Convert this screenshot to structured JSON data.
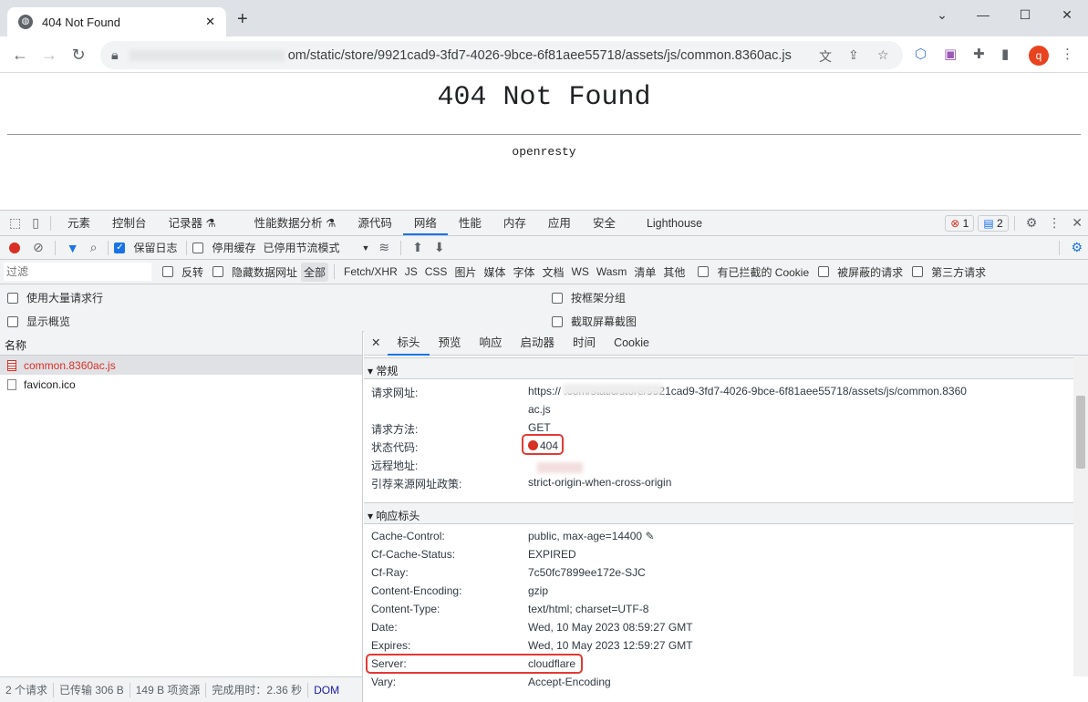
{
  "browser": {
    "tab_title": "404 Not Found",
    "new_tab": "+",
    "url": "om/static/store/9921cad9-3fd7-4026-9bce-6f81aee55718/assets/js/common.8360ac.js",
    "avatar": "q"
  },
  "page": {
    "heading": "404 Not Found",
    "server": "openresty"
  },
  "devtools": {
    "tabs": [
      "元素",
      "控制台",
      "记录器 ⚗",
      "性能数据分析 ⚗",
      "源代码",
      "网络",
      "性能",
      "内存",
      "应用",
      "安全",
      "Lighthouse"
    ],
    "error_count": "1",
    "message_count": "2",
    "toolbar": {
      "preserve_log": "保留日志",
      "disable_cache": "停用缓存",
      "throttling": "已停用节流模式"
    },
    "filter": {
      "placeholder": "过滤",
      "invert": "反转",
      "hide_data_urls": "隐藏数据网址",
      "types": [
        "全部",
        "Fetch/XHR",
        "JS",
        "CSS",
        "图片",
        "媒体",
        "字体",
        "文档",
        "WS",
        "Wasm",
        "清单",
        "其他"
      ],
      "blocked_cookies": "有已拦截的 Cookie",
      "blocked_requests": "被屏蔽的请求",
      "third_party": "第三方请求"
    },
    "options": {
      "large_rows": "使用大量请求行",
      "group_by_frame": "按框架分组",
      "overview": "显示概览",
      "screenshots": "截取屏幕截图"
    },
    "list": {
      "header": "名称",
      "items": [
        "common.8360ac.js",
        "favicon.ico"
      ]
    },
    "detail_tabs": [
      "标头",
      "预览",
      "响应",
      "启动器",
      "时间",
      "Cookie"
    ],
    "general": {
      "title": "常规",
      "rows": [
        {
          "k": "请求网址:",
          "v": "https://                          .com/static/store/9921cad9-3fd7-4026-9bce-6f81aee55718/assets/js/common.8360"
        },
        {
          "k": "",
          "v": "ac.js"
        },
        {
          "k": "请求方法:",
          "v": "GET"
        },
        {
          "k": "状态代码:",
          "v": "404"
        },
        {
          "k": "远程地址:",
          "v": ""
        },
        {
          "k": "引荐来源网址政策:",
          "v": "strict-origin-when-cross-origin"
        }
      ]
    },
    "response_headers": {
      "title": "响应标头",
      "rows": [
        {
          "k": "Cache-Control:",
          "v": "public, max-age=14400"
        },
        {
          "k": "Cf-Cache-Status:",
          "v": "EXPIRED"
        },
        {
          "k": "Cf-Ray:",
          "v": "7c50fc7899ee172e-SJC"
        },
        {
          "k": "Content-Encoding:",
          "v": "gzip"
        },
        {
          "k": "Content-Type:",
          "v": "text/html; charset=UTF-8"
        },
        {
          "k": "Date:",
          "v": "Wed, 10 May 2023 08:59:27 GMT"
        },
        {
          "k": "Expires:",
          "v": "Wed, 10 May 2023 12:59:27 GMT"
        },
        {
          "k": "Server:",
          "v": "cloudflare"
        },
        {
          "k": "Vary:",
          "v": "Accept-Encoding"
        }
      ]
    },
    "status": {
      "requests": "2 个请求",
      "transferred": "已传输 306 B",
      "resources": "149 B 项资源",
      "finish": "完成用时：2.36 秒",
      "dom": "DOM"
    }
  }
}
